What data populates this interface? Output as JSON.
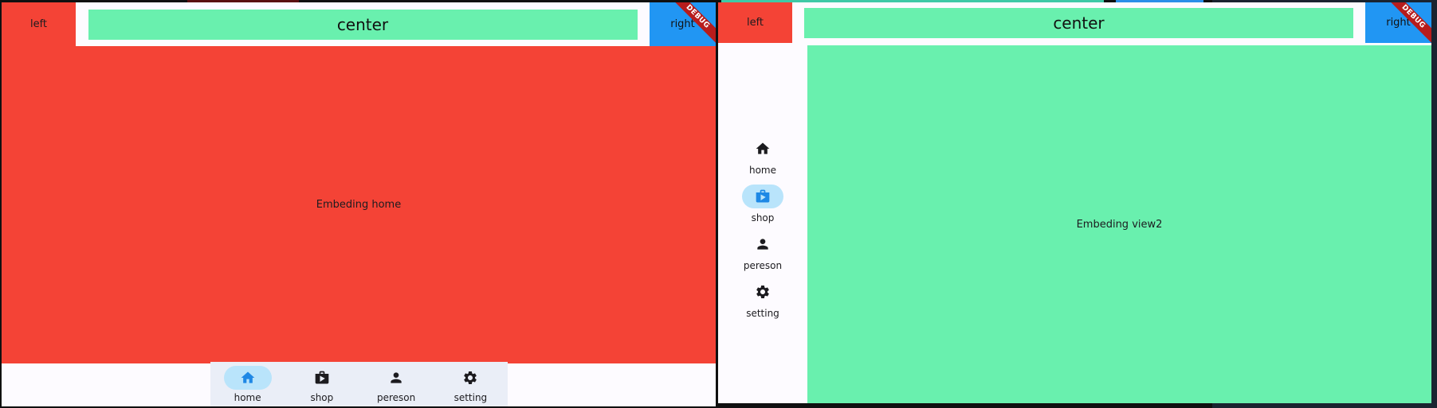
{
  "windows": [
    {
      "appbar": {
        "left": "left",
        "center": "center",
        "right": "right"
      },
      "debug_banner": "DEBUG",
      "content_text": "Embeding home",
      "content_color": "#f44336",
      "nav_type": "bottom",
      "nav": {
        "selected": "home",
        "items": [
          {
            "label": "home",
            "icon": "home-icon"
          },
          {
            "label": "shop",
            "icon": "shop-icon"
          },
          {
            "label": "pereson",
            "icon": "person-icon"
          },
          {
            "label": "setting",
            "icon": "gear-icon"
          }
        ]
      }
    },
    {
      "appbar": {
        "left": "left",
        "center": "center",
        "right": "right"
      },
      "debug_banner": "DEBUG",
      "content_text": "Embeding view2",
      "content_color": "#69f0ae",
      "nav_type": "rail",
      "nav": {
        "selected": "shop",
        "items": [
          {
            "label": "home",
            "icon": "home-icon"
          },
          {
            "label": "shop",
            "icon": "shop-icon"
          },
          {
            "label": "pereson",
            "icon": "person-icon"
          },
          {
            "label": "setting",
            "icon": "gear-icon"
          }
        ]
      }
    }
  ],
  "colors": {
    "left_block": "#f44336",
    "center_block": "#69f0ae",
    "right_block": "#2196f3",
    "selected_pill": "#b9e4fb",
    "selected_icon": "#1e88e5",
    "icon": "#1c1b1f"
  }
}
